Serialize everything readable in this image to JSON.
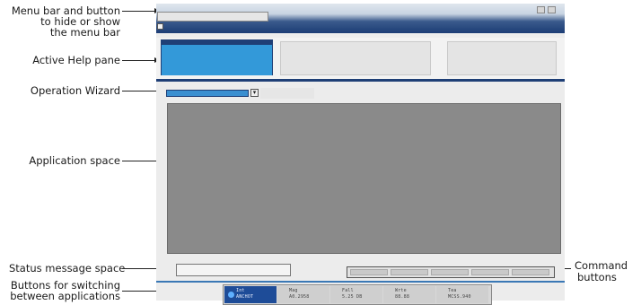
{
  "callouts": {
    "menu_bar": [
      "Menu bar and button",
      "to hide or show",
      "the menu bar"
    ],
    "active_help": "Active Help pane",
    "operation_wizard": "Operation Wizard",
    "application_space": "Application space",
    "status_message": "Status message space",
    "switch_buttons": [
      "Buttons for switching",
      "between applications"
    ],
    "command_buttons": [
      "Command",
      "buttons"
    ]
  },
  "colors": {
    "title_gradient_dark": "#1c3d75",
    "active_help": "#3399d9",
    "app_space": "#8a8a8a",
    "active_app_button": "#1e4c98"
  },
  "app_switcher": [
    {
      "name": "Int",
      "value": "ANCHOT"
    },
    {
      "name": "Mag",
      "value": "A0.2958"
    },
    {
      "name": "Fall",
      "value": "5.25 DB"
    },
    {
      "name": "Wrte",
      "value": "88.88"
    },
    {
      "name": "Tea",
      "value": "MCSS.940"
    }
  ]
}
